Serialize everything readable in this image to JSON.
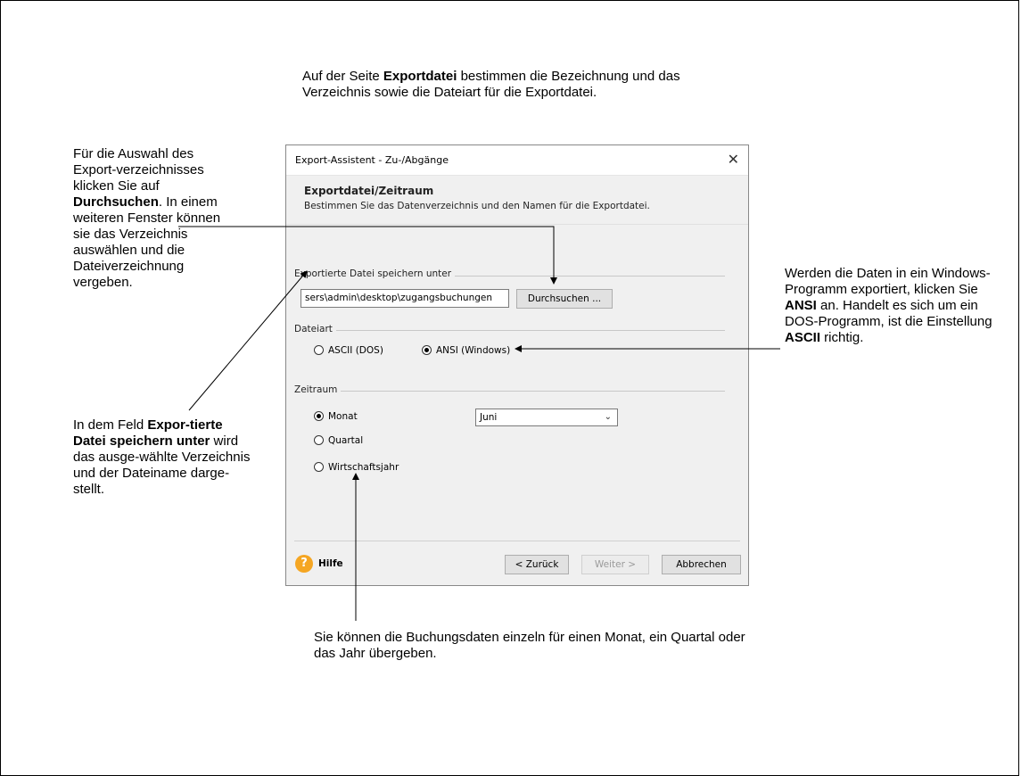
{
  "notes": {
    "top": {
      "pre": "Auf der Seite ",
      "bold": "Exportdatei",
      "post": " bestimmen die Bezeichnung und das Verzeichnis sowie die Dateiart für die Exportdatei."
    },
    "left_top": {
      "pre": "Für die Auswahl des Export-verzeichnisses klicken Sie auf ",
      "bold": "Durchsuchen",
      "post": ". In einem weiteren Fenster können sie das Verzeichnis auswählen und die Dateiverzeichnung vergeben."
    },
    "left_bottom": {
      "pre": "In dem Feld ",
      "bold": "Expor-tierte Datei speichern unter",
      "post": " wird das ausge-wählte Verzeichnis und der Dateiname darge-stellt."
    },
    "right": {
      "pre": "Werden die Daten in ein Windows-Programm exportiert, klicken Sie ",
      "bold1": "ANSI",
      "mid": " an. Handelt es sich um ein DOS-Programm, ist die Einstellung ",
      "bold2": "ASCII",
      "post": " richtig."
    },
    "bottom": "Sie können die Buchungsdaten einzeln für einen Monat, ein Quartal oder das Jahr übergeben."
  },
  "dialog": {
    "title": "Export-Assistent - Zu-/Abgänge",
    "close": "✕",
    "header_title": "Exportdatei/Zeitraum",
    "header_subtitle": "Bestimmen Sie das Datenverzeichnis und den Namen für die Exportdatei.",
    "group_file": "Exportierte Datei speichern unter",
    "path_value": "sers\\admin\\desktop\\zugangsbuchungen",
    "browse_button": "Durchsuchen ...",
    "group_filetype": "Dateiart",
    "radio_ascii": "ASCII (DOS)",
    "radio_ansi": "ANSI (Windows)",
    "group_period": "Zeitraum",
    "radio_month": "Monat",
    "radio_quarter": "Quartal",
    "radio_fiscal": "Wirtschaftsjahr",
    "month_selected": "Juni",
    "help": "Hilfe",
    "help_icon": "?",
    "back_button": "< Zurück",
    "next_button": "Weiter >",
    "cancel_button": "Abbrechen"
  }
}
